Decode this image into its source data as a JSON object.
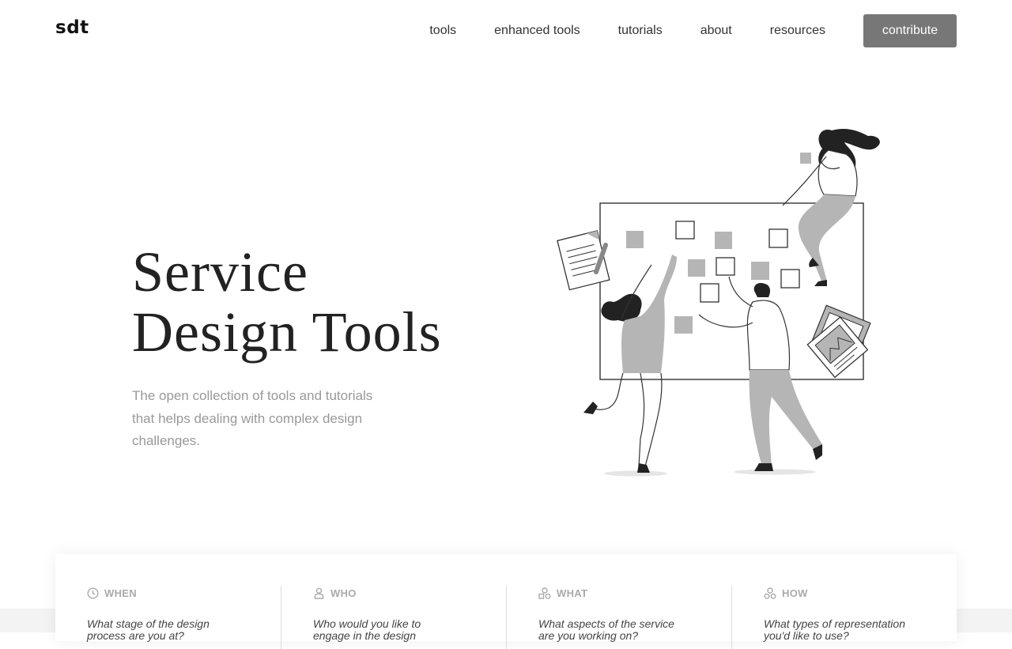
{
  "header": {
    "logo": "sdt",
    "nav": [
      "tools",
      "enhanced tools",
      "tutorials",
      "about",
      "resources"
    ],
    "contribute_label": "contribute"
  },
  "hero": {
    "title_line1": "Service",
    "title_line2": "Design Tools",
    "subtitle": "The open collection of tools and tutorials that helps dealing with complex design challenges."
  },
  "filters": [
    {
      "label": "WHEN",
      "icon": "clock-icon",
      "question": "What stage of the design process are you at?"
    },
    {
      "label": "WHO",
      "icon": "person-icon",
      "question": "Who would you like to engage in the design"
    },
    {
      "label": "WHAT",
      "icon": "shapes-icon",
      "question": "What aspects of the service are you working on?"
    },
    {
      "label": "HOW",
      "icon": "shapes-icon",
      "question": "What types of representation you'd like to use?"
    }
  ],
  "colors": {
    "button_bg": "#777777",
    "illustration_gray": "#b5b5b5",
    "accent_dark": "#222222"
  }
}
